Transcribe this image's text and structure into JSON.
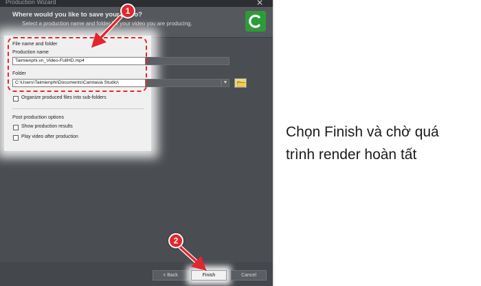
{
  "window": {
    "title": "Production Wizard",
    "heading": "Where would you like to save your video?",
    "subheading": "Select a production name and folder for your video you are producing."
  },
  "file_group": {
    "label": "File name and folder",
    "production_name_label": "Production name",
    "production_name_value": "Taimienphi.vn_Video-FullHD.mp4",
    "folder_label": "Folder",
    "folder_value": "C:\\Users\\Taimienphi\\Documents\\Camtasia Studio\\",
    "organize_label": "Organize produced files into sub-folders",
    "organize_checked": false
  },
  "post_group": {
    "label": "Post production options",
    "show_results_label": "Show production results",
    "show_results_checked": false,
    "play_video_label": "Play video after production",
    "play_video_checked": false
  },
  "buttons": {
    "back": "< Back",
    "finish": "Finish",
    "cancel": "Cancel"
  },
  "steps": {
    "step1": "1",
    "step2": "2"
  },
  "caption": {
    "line1": "Chọn Finish và chờ quá",
    "line2": "trình render hoàn tất"
  },
  "colors": {
    "highlight_red": "#e3262e",
    "logo_green": "#2e9b3a",
    "window_dark": "#4a4d52"
  },
  "icons": {
    "close": "close-icon",
    "logo": "camtasia-logo-icon",
    "browse": "folder-icon",
    "dropdown": "chevron-down-icon"
  }
}
